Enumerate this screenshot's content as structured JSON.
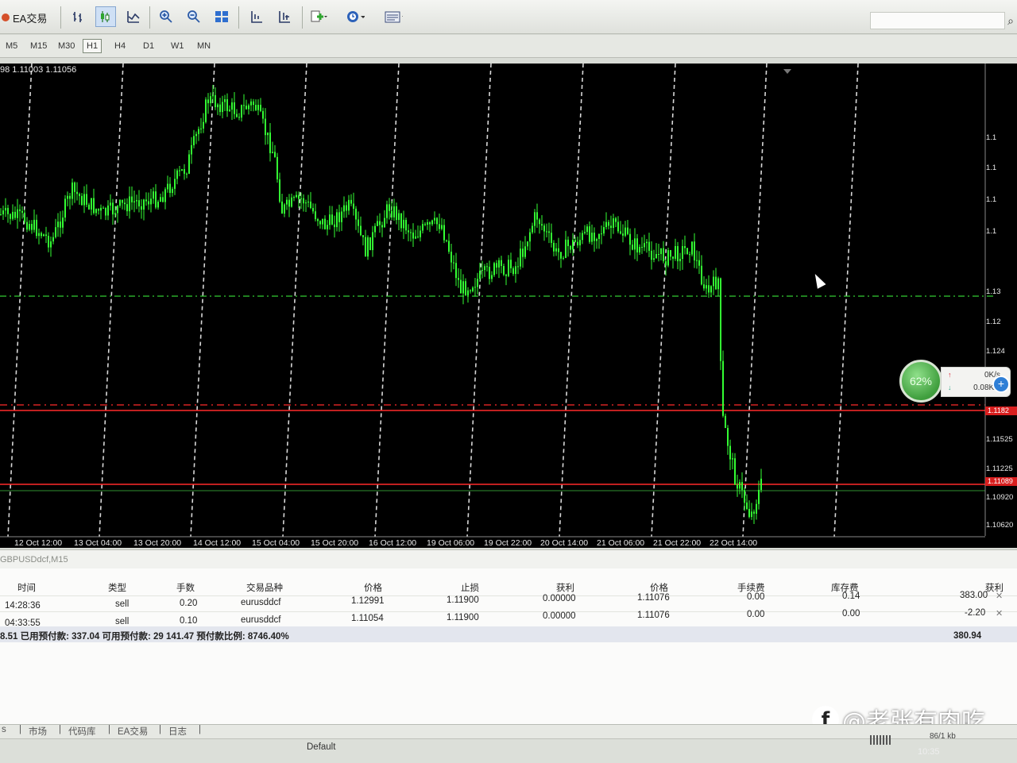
{
  "toolbar": {
    "ea_label": "EA交易",
    "icons": [
      "bar-chart-icon",
      "candlestick-icon",
      "line-chart-icon",
      "zoom-in-icon",
      "zoom-out-icon",
      "tile-windows-icon",
      "auto-scroll-icon",
      "chart-shift-icon",
      "indicators-icon",
      "period-icon",
      "templates-icon"
    ]
  },
  "timeframes": [
    "M5",
    "M15",
    "M30",
    "H1",
    "H4",
    "D1",
    "W1",
    "MN"
  ],
  "timeframe_selected": "H1",
  "chart": {
    "ohlc_text": "98 1.11003 1.11056",
    "price_labels": [
      "1.1",
      "1.1",
      "1.1",
      "1.1",
      "1.13",
      "1.12",
      "1.124",
      "1.1182",
      "1.11525",
      "1.11225",
      "1.11089",
      "1.10920",
      "1.10620"
    ],
    "time_labels": [
      "12 Oct 12:00",
      "13 Oct 04:00",
      "13 Oct 20:00",
      "14 Oct 12:00",
      "15 Oct 04:00",
      "15 Oct 20:00",
      "16 Oct 12:00",
      "19 Oct 06:00",
      "19 Oct 22:00",
      "20 Oct 14:00",
      "21 Oct 06:00",
      "21 Oct 22:00",
      "22 Oct 14:00"
    ],
    "candle_color": "#33ff33",
    "background": "#000000",
    "red_lines_color": "#ff2a2a",
    "green_level_color": "#33cc33"
  },
  "net_widget": {
    "percent": "62%",
    "upload": "0K/s",
    "download": "0.08K/s"
  },
  "chart_tab": "GBPUSDdcf,M15",
  "terminal": {
    "columns": [
      "时间",
      "类型",
      "手数",
      "交易品种",
      "价格",
      "止损",
      "获利",
      "价格",
      "手续费",
      "库存费",
      "获利"
    ],
    "rows": [
      {
        "time": "14:28:36",
        "type": "sell",
        "lots": "0.20",
        "symbol": "eurusddcf",
        "price": "1.12991",
        "sl": "1.11900",
        "tp": "0.00000",
        "cur_price": "1.11076",
        "commission": "0.00",
        "swap": "0.14",
        "profit": "383.00"
      },
      {
        "time": "04:33:55",
        "type": "sell",
        "lots": "0.10",
        "symbol": "eurusddcf",
        "price": "1.11054",
        "sl": "1.11900",
        "tp": "0.00000",
        "cur_price": "1.11076",
        "commission": "0.00",
        "swap": "0.00",
        "profit": "-2.20"
      }
    ],
    "summary": "8.51  已用预付款: 337.04  可用预付款: 29 141.47  预付款比例: 8746.40%",
    "total_profit": "380.94"
  },
  "bottom_tabs": [
    "s",
    "市场",
    "代码库",
    "EA交易",
    "日志"
  ],
  "status": {
    "profile": "Default",
    "traffic": "86/1 kb",
    "clock": "10:35"
  },
  "watermark": "@老张有肉吃"
}
